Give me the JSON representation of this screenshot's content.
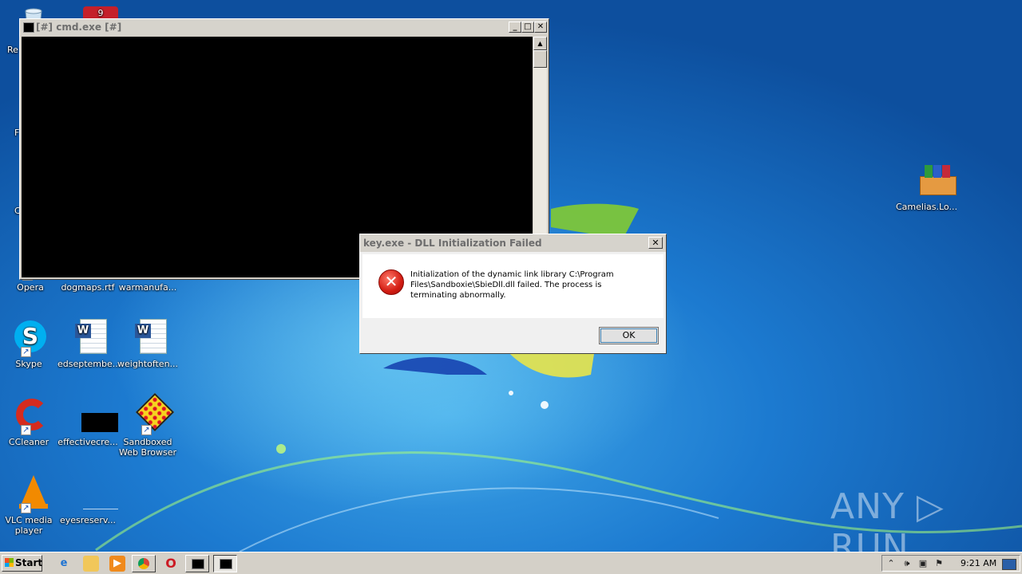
{
  "desktop": {
    "icons": [
      {
        "label": "Re",
        "kind": "recycle"
      },
      {
        "label": "F",
        "kind": "firefox"
      },
      {
        "label": "C",
        "kind": "chrome"
      },
      {
        "label": "Opera",
        "kind": "opera"
      },
      {
        "label": "dogmaps.rtf",
        "kind": "doc"
      },
      {
        "label": "warmanufa...",
        "kind": "doc"
      },
      {
        "label": "Skype",
        "kind": "skype"
      },
      {
        "label": "edseptembe...",
        "kind": "word"
      },
      {
        "label": "weightoften...",
        "kind": "word"
      },
      {
        "label": "CCleaner",
        "kind": "ccleaner"
      },
      {
        "label": "effectivecre...",
        "kind": "black"
      },
      {
        "label": "Sandboxed Web Browser",
        "kind": "sandboxie"
      },
      {
        "label": "VLC media player",
        "kind": "vlc"
      },
      {
        "label": "eyesreserv...",
        "kind": "blank"
      },
      {
        "label": "Camelias.Lo...",
        "kind": "winrar"
      }
    ]
  },
  "cmd_window": {
    "title": "[#] cmd.exe [#]",
    "minimize": "_",
    "maximize": "□",
    "close": "✕"
  },
  "dialog": {
    "title": "key.exe - DLL Initialization Failed",
    "close": "✕",
    "message": "Initialization of the dynamic link library C:\\Program Files\\Sandboxie\\SbieDll.dll failed. The process is terminating abnormally.",
    "ok_label": "OK",
    "icon": "error-icon"
  },
  "taskbar": {
    "start_label": "Start",
    "quick_launch": [
      "ie-icon",
      "folder-icon",
      "media-icon",
      "chrome-icon",
      "opera-icon"
    ],
    "tray": {
      "clock": "9:21 AM",
      "icons": [
        "chevron-up-icon",
        "volume-icon",
        "network-icon",
        "flag-icon",
        "desktop-icon"
      ]
    }
  },
  "watermark": "ANY ▷ RUN"
}
